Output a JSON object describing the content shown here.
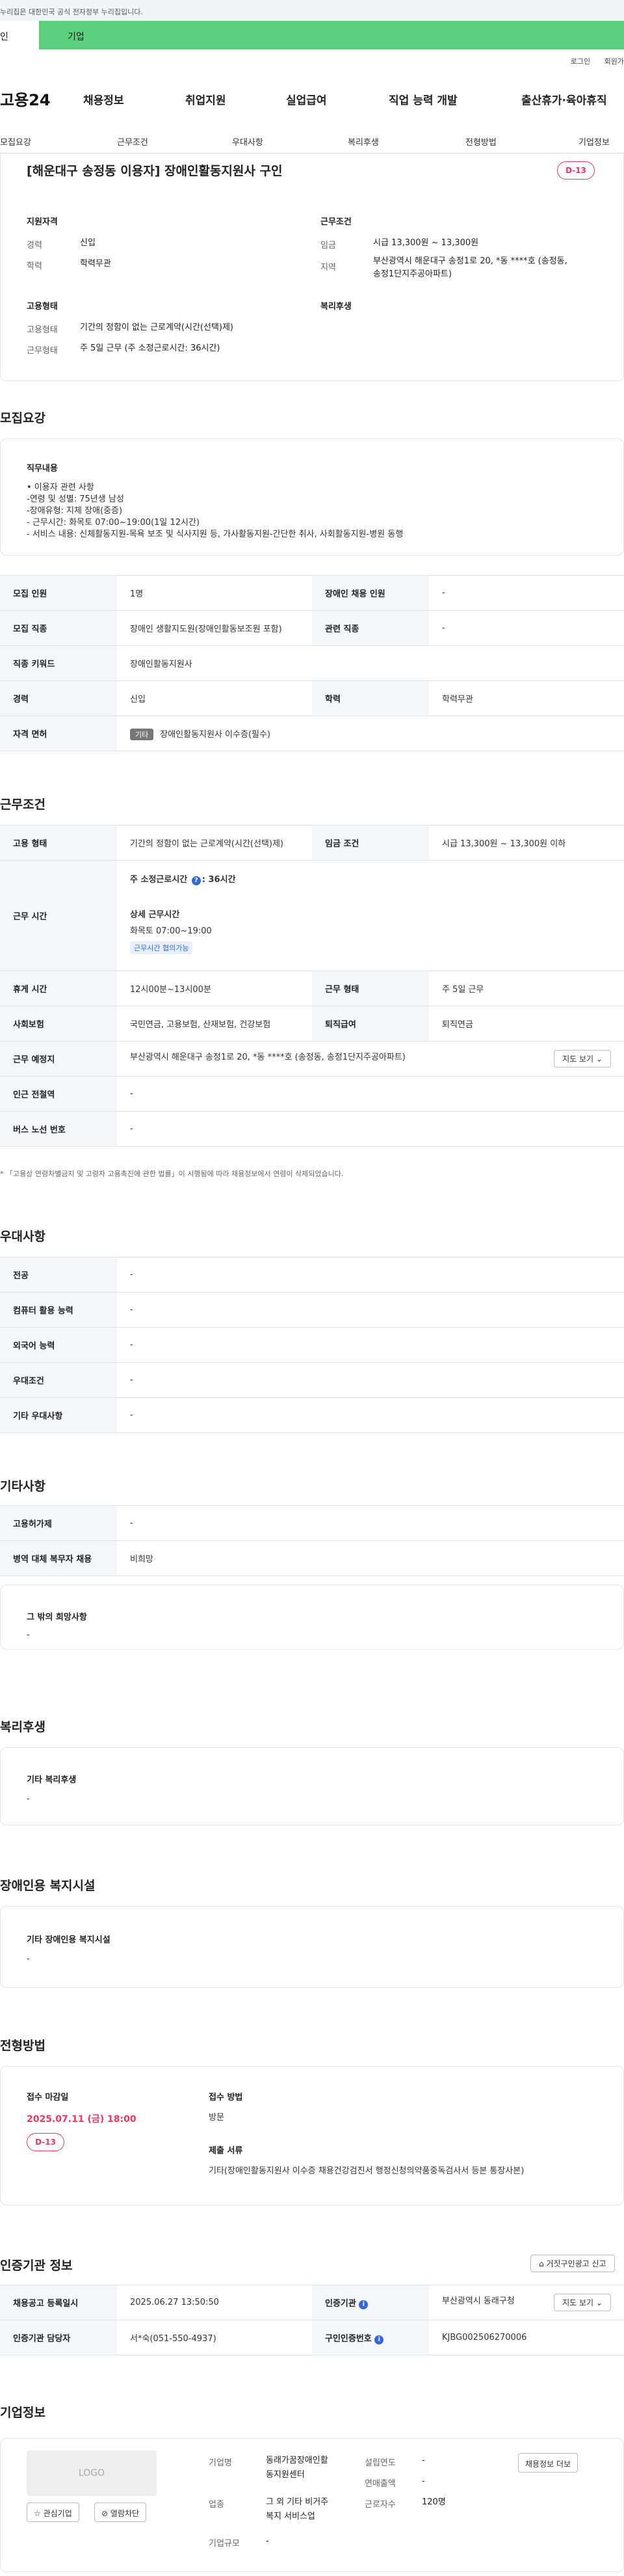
{
  "header": {
    "gov_notice": "누리집은 대한민국 공식 전자정부 누리집입니다.",
    "tab_personal": "인",
    "tab_company": "기업",
    "util_login": "로그인",
    "util_join": "회원가",
    "logo": "고용24",
    "menu": [
      "채용정보",
      "취업지원",
      "실업급여",
      "직업 능력 개발",
      "출산휴가·육아휴직"
    ]
  },
  "subnav": [
    "모집요강",
    "근무조건",
    "우대사항",
    "복리후생",
    "전형방법",
    "기업정보"
  ],
  "summary": {
    "title": "[해운대구 송정동 이용자] 장애인활동지원사 구인",
    "dday": "D-13",
    "qual_heading": "지원자격",
    "career_label": "경력",
    "career_value": "신입",
    "edu_label": "학력",
    "edu_value": "학력무관",
    "work_heading": "근무조건",
    "wage_label": "임금",
    "wage_value": "시급 13,300원 ~ 13,300원",
    "area_label": "지역",
    "area_value1": "부산광역시 해운대구 송정1로 20, *동 ****호 (송정동,",
    "area_value2": "송정1단지주공아파트)",
    "emp_heading": "고용형태",
    "emp_label": "고용형태",
    "emp_value": "기간의 정함이 없는 근로계약(시간(선택)제)",
    "worktype_label": "근무형태",
    "worktype_value": "주 5일 근무 (주 소정근로시간: 36시간)",
    "benefit_heading": "복리후생"
  },
  "recruit": {
    "title": "모집요강",
    "duty_heading": "직무내용",
    "duty_lines": [
      "• 이용자 관련 사항",
      "-연령 및 성별: 75년생 남성",
      "-장애유형: 지체 장애(중증)",
      "- 근무시간: 화목토 07:00~19:00(1일 12시간)",
      "- 서비스 내용: 신체활동지원-목욕 보조 및 식사지원 등, 가사활동지원-간단한 취사, 사회활동지원-병원 동행"
    ],
    "labels": {
      "headcount": "모집 인원",
      "disabled_hire": "장애인 채용 인원",
      "job": "모집 직종",
      "related_job": "관련 직종",
      "keyword": "직종 키워드",
      "career": "경력",
      "education": "학력",
      "license": "자격 면허"
    },
    "values": {
      "headcount": "1명",
      "disabled_hire": "-",
      "job": "장애인 생활지도원(장애인활동보조원 포함)",
      "related_job": "-",
      "keyword": "장애인활동지원사",
      "career": "신입",
      "education": "학력무관",
      "license_badge": "기타",
      "license": "장애인활동지원사 이수증(필수)"
    }
  },
  "conditions": {
    "title": "근무조건",
    "labels": {
      "employment": "고용 형태",
      "wage": "임금 조건",
      "hours": "근무 시간",
      "break": "휴게 시간",
      "worktype": "근무 형태",
      "insurance": "사회보험",
      "retirement": "퇴직급여",
      "location": "근무 예정지",
      "station": "인근 전철역",
      "bus": "버스 노선 번호"
    },
    "values": {
      "employment": "기간의 정함이 없는 근로계약(시간(선택)제)",
      "wage": "시급 13,300원 ~ 13,300원 이하",
      "hours_main": "주 소정근로시간",
      "hours_main_value": "36시간",
      "hours_detail_title": "상세 근무시간",
      "hours_detail": "화목토 07:00~19:00",
      "hours_tag": "근무시간 협의가능",
      "break": "12시00분~13시00분",
      "worktype": "주 5일 근무",
      "insurance": "국민연금, 고용보험, 산재보험, 건강보험",
      "retirement": "퇴직연금",
      "location": "부산광역시 해운대구 송정1로 20, *동 ****호 (송정동, 송정1단지주공아파트)",
      "map_button": "지도 보기",
      "station": "-",
      "bus": "-"
    },
    "note": "* 「고용상 연령차별금지 및 고령자 고용촉진에 관한 법률」이 시행됨에 따라 채용정보에서 연령이 삭제되었습니다."
  },
  "preference": {
    "title": "우대사항",
    "rows": [
      {
        "label": "전공",
        "value": "-"
      },
      {
        "label": "컴퓨터 활용 능력",
        "value": "-"
      },
      {
        "label": "외국어 능력",
        "value": "-"
      },
      {
        "label": "우대조건",
        "value": "-"
      },
      {
        "label": "기타 우대사항",
        "value": "-"
      }
    ]
  },
  "etc": {
    "title": "기타사항",
    "rows": [
      {
        "label": "고용허가제",
        "value": "-"
      },
      {
        "label": "병역 대체 복무자 채용",
        "value": "비희망"
      }
    ],
    "box_heading": "그 밖의 희망사항",
    "box_value": "-"
  },
  "welfare": {
    "title": "복리후생",
    "heading": "기타 복리후생",
    "value": "-"
  },
  "facility": {
    "title": "장애인용 복지시설",
    "heading": "기타 장애인용 복지시설",
    "value": "-"
  },
  "selection": {
    "title": "전형방법",
    "deadline_label": "접수 마감일",
    "deadline": "2025.07.11 (금) 18:00",
    "dday": "D-13",
    "method_label": "접수 방법",
    "method": "방문",
    "docs_label": "제출 서류",
    "docs": "기타(장애인활동지원사 이수증 채용건강검진서 행정신청의약품중독검사서 등본 통장사본)"
  },
  "certification": {
    "title": "인증기관 정보",
    "report_button": "거짓구인광고 신고",
    "labels": {
      "registered": "채용공고 등록일시",
      "agency": "인증기관",
      "manager": "인증기관 담당자",
      "cert_no": "구인인증번호"
    },
    "values": {
      "registered": "2025.06.27 13:50:50",
      "agency": "부산광역시 동래구청",
      "manager": "서*숙(051-550-4937)",
      "cert_no": "KJBG002506270006",
      "map_button": "지도 보기"
    }
  },
  "company": {
    "title": "기업정보",
    "logo_text": "LOGO",
    "fav_button": "관심기업",
    "block_button": "열람차단",
    "info_button": "채용정보 더보",
    "labels": {
      "name": "기업명",
      "industry": "업종",
      "size": "기업규모",
      "founded": "설립연도",
      "sales": "연매출액",
      "employees": "근로자수"
    },
    "values": {
      "name1": "동래가꿈장애인활",
      "name2": "동지원센터",
      "industry1": "그 외 기타 비거주",
      "industry2": "복지 서비스업",
      "size": "-",
      "founded": "-",
      "sales": "-",
      "employees": "120명"
    }
  }
}
